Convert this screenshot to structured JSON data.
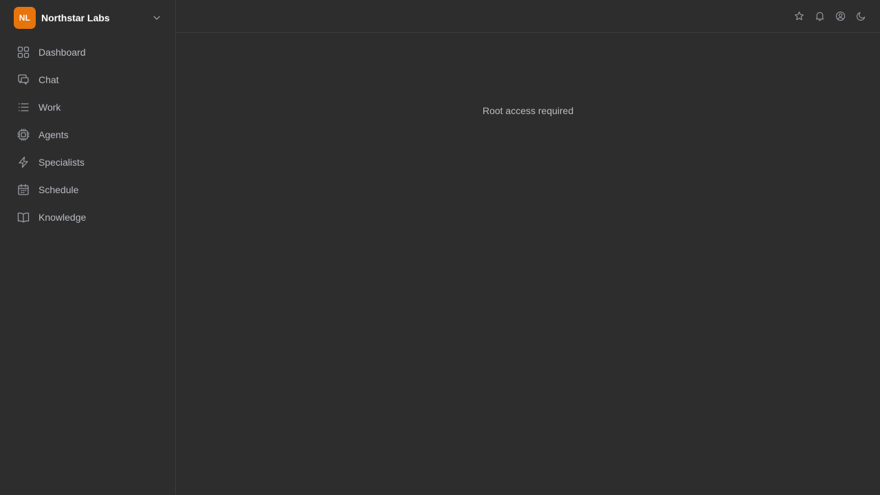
{
  "org": {
    "initials": "NL",
    "name": "Northstar Labs",
    "avatar_color": "#e8740c",
    "chevron_icon": "chevron-down-icon"
  },
  "sidebar": {
    "items": [
      {
        "label": "Dashboard",
        "icon": "dashboard-grid-icon"
      },
      {
        "label": "Chat",
        "icon": "chat-bubbles-icon"
      },
      {
        "label": "Work",
        "icon": "list-icon"
      },
      {
        "label": "Agents",
        "icon": "cpu-chip-icon"
      },
      {
        "label": "Specialists",
        "icon": "lightning-bolt-icon"
      },
      {
        "label": "Schedule",
        "icon": "calendar-icon"
      },
      {
        "label": "Knowledge",
        "icon": "book-open-icon"
      }
    ]
  },
  "topbar": {
    "icons": [
      "star-icon",
      "bell-icon",
      "user-circle-icon",
      "moon-icon"
    ]
  },
  "main": {
    "message": "Root access required"
  },
  "colors": {
    "background": "#2d2d2d",
    "border": "#3d3d3d",
    "muted_text": "#b9bcc4",
    "icon": "#9a9da5"
  }
}
